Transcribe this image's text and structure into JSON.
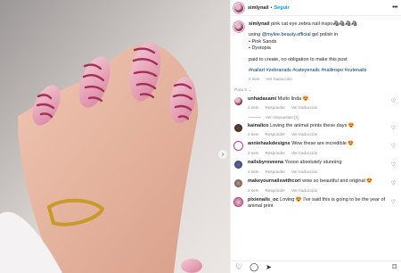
{
  "header": {
    "username": "simlynail",
    "separator": "•",
    "follow_label": "Seguir",
    "more_icon": "more-horizontal-icon"
  },
  "caption": {
    "username": "simlynail",
    "title": "pink cat eye zebra nail inspo🦓🦓🦓🦓",
    "line_using_pre": "using ",
    "line_using_mention": "@mylee.beauty.official",
    "line_using_post": " gel polish in",
    "colors": [
      "• Pink Sands",
      "• Dystopia"
    ],
    "paid_note": "paid to create, no obligation to make this post",
    "hashtags": "#nailart #zebranails #cateyenails #nailinspo #cutenails",
    "time": "2 sem",
    "translate": "Ver traducción"
  },
  "section_label": "Para ti ⌄",
  "comments": [
    {
      "username": "unhadasami",
      "text": "Muito linda 😍",
      "time": "2 sem",
      "reply": "Responder",
      "translate": "Ver traducción",
      "replies": "Ver respuestas (1)"
    },
    {
      "username": "kainalico",
      "text": "Loving the animal prints these days 😍",
      "time": "2 sem",
      "reply": "Responder",
      "translate": "Ver traducción"
    },
    {
      "username": "anniehaskdesigns",
      "text": "Wow these are incredible 😍",
      "time": "2 sem",
      "reply": "Responder",
      "translate": "Ver traducción"
    },
    {
      "username": "nailsbyroveena",
      "text": "Yoooo absolutely stunning",
      "time": "2 sem",
      "reply": "Responder",
      "translate": "Ver traducción"
    },
    {
      "username": "makeyournailswithcori",
      "text": "wow so beautiful and original 😍",
      "time": "2 sem",
      "reply": "Responder",
      "translate": "Ver traducción"
    },
    {
      "username": "pixienails_oc",
      "text": "Loving 😍 I've said this is going to be the year of animal print",
      "time": "",
      "reply": "",
      "translate": ""
    }
  ],
  "footer": {
    "icons": [
      "heart-icon",
      "comment-icon",
      "share-icon",
      "bookmark-icon"
    ],
    "glyphs": {
      "heart": "♡",
      "comment": "◯",
      "share": "➤",
      "bookmark": "⌑"
    }
  },
  "colors": {
    "link": "#0095f6",
    "hashtag": "#00376b",
    "muted": "#8e8e8e",
    "nail_pink": "#c94d78"
  }
}
